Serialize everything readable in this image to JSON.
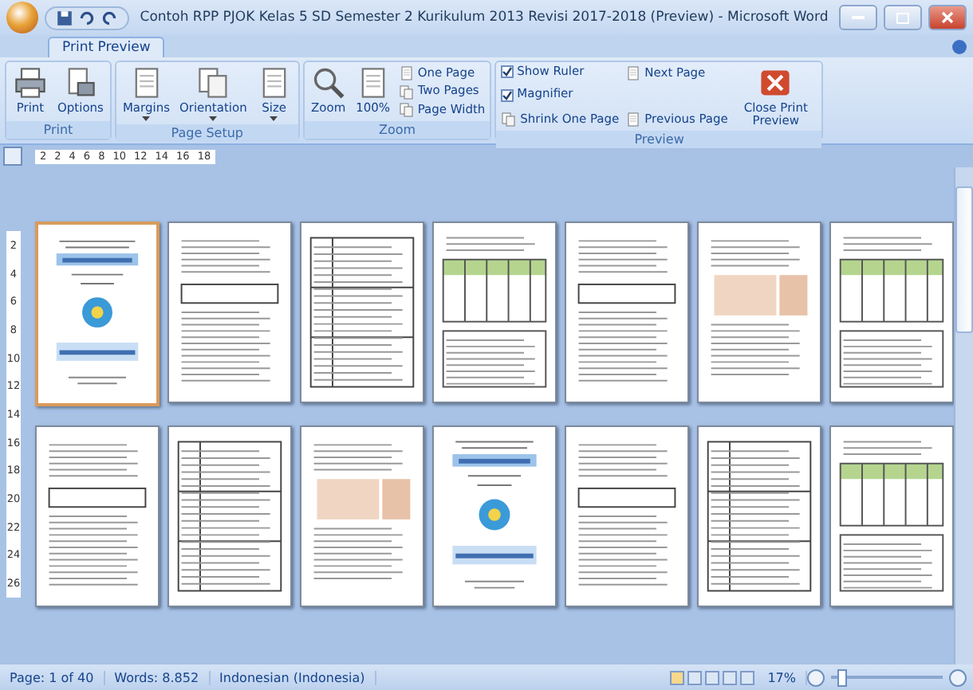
{
  "window": {
    "title": "Contoh RPP PJOK Kelas 5 SD Semester 2 Kurikulum 2013 Revisi 2017-2018 (Preview) - Microsoft Word"
  },
  "tabs": [
    {
      "label": "Print Preview",
      "selected": true
    }
  ],
  "ribbon": {
    "groups": [
      {
        "label": "Print",
        "items": [
          {
            "kind": "large",
            "label": "Print"
          },
          {
            "kind": "large",
            "label": "Options"
          }
        ]
      },
      {
        "label": "Page Setup",
        "items": [
          {
            "kind": "large",
            "label": "Margins"
          },
          {
            "kind": "large",
            "label": "Orientation"
          },
          {
            "kind": "large",
            "label": "Size"
          }
        ]
      },
      {
        "label": "Zoom",
        "items": [
          {
            "kind": "large",
            "label": "Zoom"
          },
          {
            "kind": "large",
            "label": "100%"
          },
          {
            "kind": "small",
            "label": "One Page"
          },
          {
            "kind": "small",
            "label": "Two Pages"
          },
          {
            "kind": "small",
            "label": "Page Width"
          }
        ]
      },
      {
        "label": "Preview",
        "items": [
          {
            "kind": "check",
            "label": "Show Ruler",
            "checked": true
          },
          {
            "kind": "check",
            "label": "Magnifier",
            "checked": true
          },
          {
            "kind": "small",
            "label": "Shrink One Page"
          },
          {
            "kind": "small",
            "label": "Next Page"
          },
          {
            "kind": "small",
            "label": "Previous Page"
          },
          {
            "kind": "large",
            "label": "Close Print Preview"
          }
        ]
      }
    ]
  },
  "ruler": {
    "labels": [
      "2",
      "2",
      "4",
      "6",
      "8",
      "10",
      "12",
      "14",
      "16",
      "18"
    ]
  },
  "vertical_ruler": {
    "labels": [
      "2",
      "4",
      "6",
      "8",
      "10",
      "12",
      "14",
      "16",
      "18",
      "20",
      "22",
      "24",
      "26"
    ]
  },
  "pages": [
    {
      "kind": "cover",
      "selected": true
    },
    {
      "kind": "text",
      "selected": false
    },
    {
      "kind": "table",
      "selected": false
    },
    {
      "kind": "grid",
      "selected": false
    },
    {
      "kind": "text",
      "selected": false
    },
    {
      "kind": "image",
      "selected": false
    },
    {
      "kind": "grid",
      "selected": false
    },
    {
      "kind": "text",
      "selected": false
    },
    {
      "kind": "table",
      "selected": false
    },
    {
      "kind": "image",
      "selected": false
    },
    {
      "kind": "cover",
      "selected": false
    },
    {
      "kind": "text",
      "selected": false
    },
    {
      "kind": "table",
      "selected": false
    },
    {
      "kind": "grid",
      "selected": false
    }
  ],
  "status_bar": {
    "page": "Page: 1 of 40",
    "words": "Words: 8.852",
    "language": "Indonesian (Indonesia)",
    "zoom": "17%",
    "zoom_level": {
      "level": 0.05
    }
  }
}
